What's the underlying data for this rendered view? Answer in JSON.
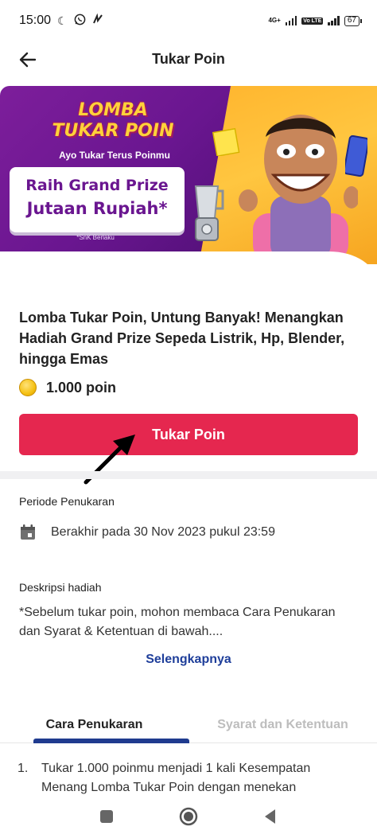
{
  "status_bar": {
    "time": "15:00",
    "network": "4G+",
    "volte": "Vo LTE",
    "battery": "67"
  },
  "app_bar": {
    "title": "Tukar Poin",
    "back_icon": "arrow-left-icon"
  },
  "banner": {
    "title_line1": "LOMBA",
    "title_line2": "TUKAR POIN",
    "tagline": "Ayo Tukar Terus Poinmu",
    "prize_line1": "Raih Grand Prize",
    "prize_line2": "Jutaan Rupiah*",
    "terms": "*SnK Berlaku"
  },
  "reward": {
    "headline": "Lomba Tukar Poin, Untung Banyak! Menangkan Hadiah Grand Prize Sepeda Listrik, Hp, Blender, hingga Emas",
    "points": "1.000 poin",
    "cta_label": "Tukar Poin"
  },
  "periode": {
    "label": "Periode Penukaran",
    "value": "Berakhir pada 30 Nov 2023 pukul 23:59",
    "icon": "calendar-icon"
  },
  "deskripsi": {
    "label": "Deskripsi hadiah",
    "text": "*Sebelum tukar poin, mohon membaca Cara Penukaran dan Syarat & Ketentuan di bawah....",
    "more_link": "Selengkapnya"
  },
  "tabs": [
    {
      "label": "Cara Penukaran",
      "active": true
    },
    {
      "label": "Syarat dan Ketentuan",
      "active": false
    }
  ],
  "steps": [
    {
      "num": "1.",
      "text": "Tukar 1.000 poinmu menjadi 1 kali Kesempatan Menang Lomba Tukar Poin dengan menekan"
    }
  ],
  "colors": {
    "primary_cta": "#e5274f",
    "link": "#1e3e9a",
    "tab_indicator": "#1f3b8f",
    "banner_purple": "#6a1690",
    "banner_yellow": "#ffc640"
  }
}
